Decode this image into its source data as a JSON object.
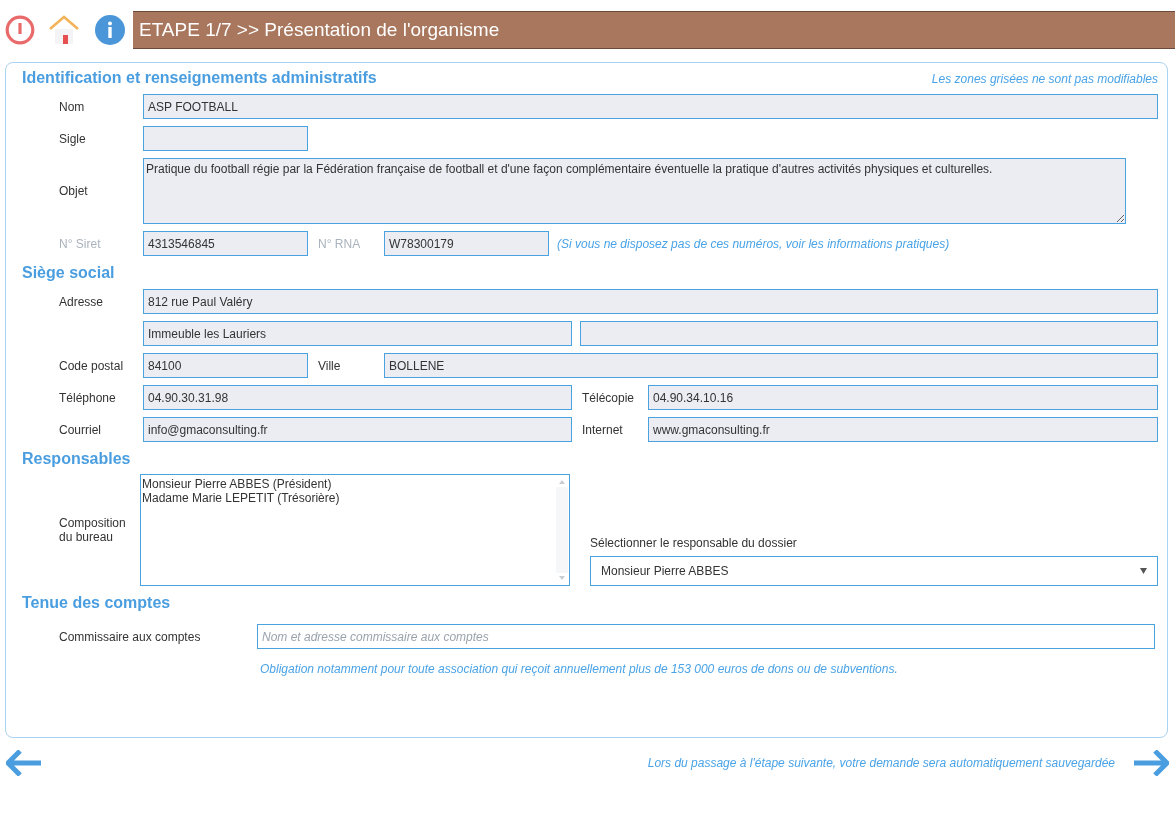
{
  "header": {
    "title": "ETAPE 1/7 >> Présentation de l'organisme"
  },
  "identification": {
    "title": "Identification et renseignements administratifs",
    "note": "Les zones grisées ne sont pas modifiables",
    "nom": {
      "label": "Nom",
      "value": "ASP FOOTBALL",
      "disabled": true
    },
    "sigle": {
      "label": "Sigle",
      "disabled": true
    },
    "objet": {
      "label": "Objet",
      "value": "Pratique du football régie par la Fédération française de football et d'une façon complémentaire éventuelle la pratique d'autres activités physiques et culturelles.",
      "disabled": true
    },
    "siret": {
      "label": "N° Siret",
      "label_disabled": true,
      "value": "4313546845",
      "disabled": true
    },
    "rna": {
      "label": "N° RNA",
      "label_disabled": true,
      "value": "W78300179",
      "disabled": true
    },
    "numbers_note": "(Si vous ne disposez pas de ces numéros, voir les informations pratiques)"
  },
  "siege": {
    "title": "Siège social",
    "adresse": {
      "label": "Adresse",
      "lines": [
        {
          "value": "812 rue Paul Valéry",
          "disabled": true
        },
        {
          "value": "Immeuble les Lauriers",
          "disabled": true
        },
        {
          "disabled": true
        }
      ]
    },
    "code_postal": {
      "label": "Code postal",
      "value": "84100",
      "disabled": true
    },
    "ville": {
      "label": "Ville",
      "value": "BOLLENE",
      "disabled": true
    },
    "telephone": {
      "label": "Téléphone",
      "value": "04.90.30.31.98",
      "disabled": true
    },
    "telecopie": {
      "label": "Télécopie",
      "value": "04.90.34.10.16",
      "disabled": true
    },
    "courriel": {
      "label": "Courriel",
      "value": "info@gmaconsulting.fr",
      "disabled": true
    },
    "internet": {
      "label": "Internet",
      "value": "www.gmaconsulting.fr",
      "disabled": true
    }
  },
  "responsables": {
    "title": "Responsables",
    "bureau": {
      "label": "Composition du bureau",
      "lines": [
        "Monsieur Pierre ABBES (Président)",
        "Madame Marie LEPETIT (Trésorière)"
      ]
    },
    "responsable": {
      "label": "Sélectionner le responsable du dossier",
      "value": "Monsieur Pierre ABBES"
    }
  },
  "comptes": {
    "title": "Tenue des comptes",
    "commissaire": {
      "label": "Commissaire aux comptes",
      "placeholder": "Nom et adresse commissaire aux comptes",
      "disabled": false
    },
    "note": "Obligation notamment pour toute association qui reçoit annuellement plus de 153 000 euros de dons ou de subventions."
  },
  "footer": {
    "save_note": "Lors du passage à l'étape suivante, votre demande sera automatiquement sauvegardée"
  }
}
